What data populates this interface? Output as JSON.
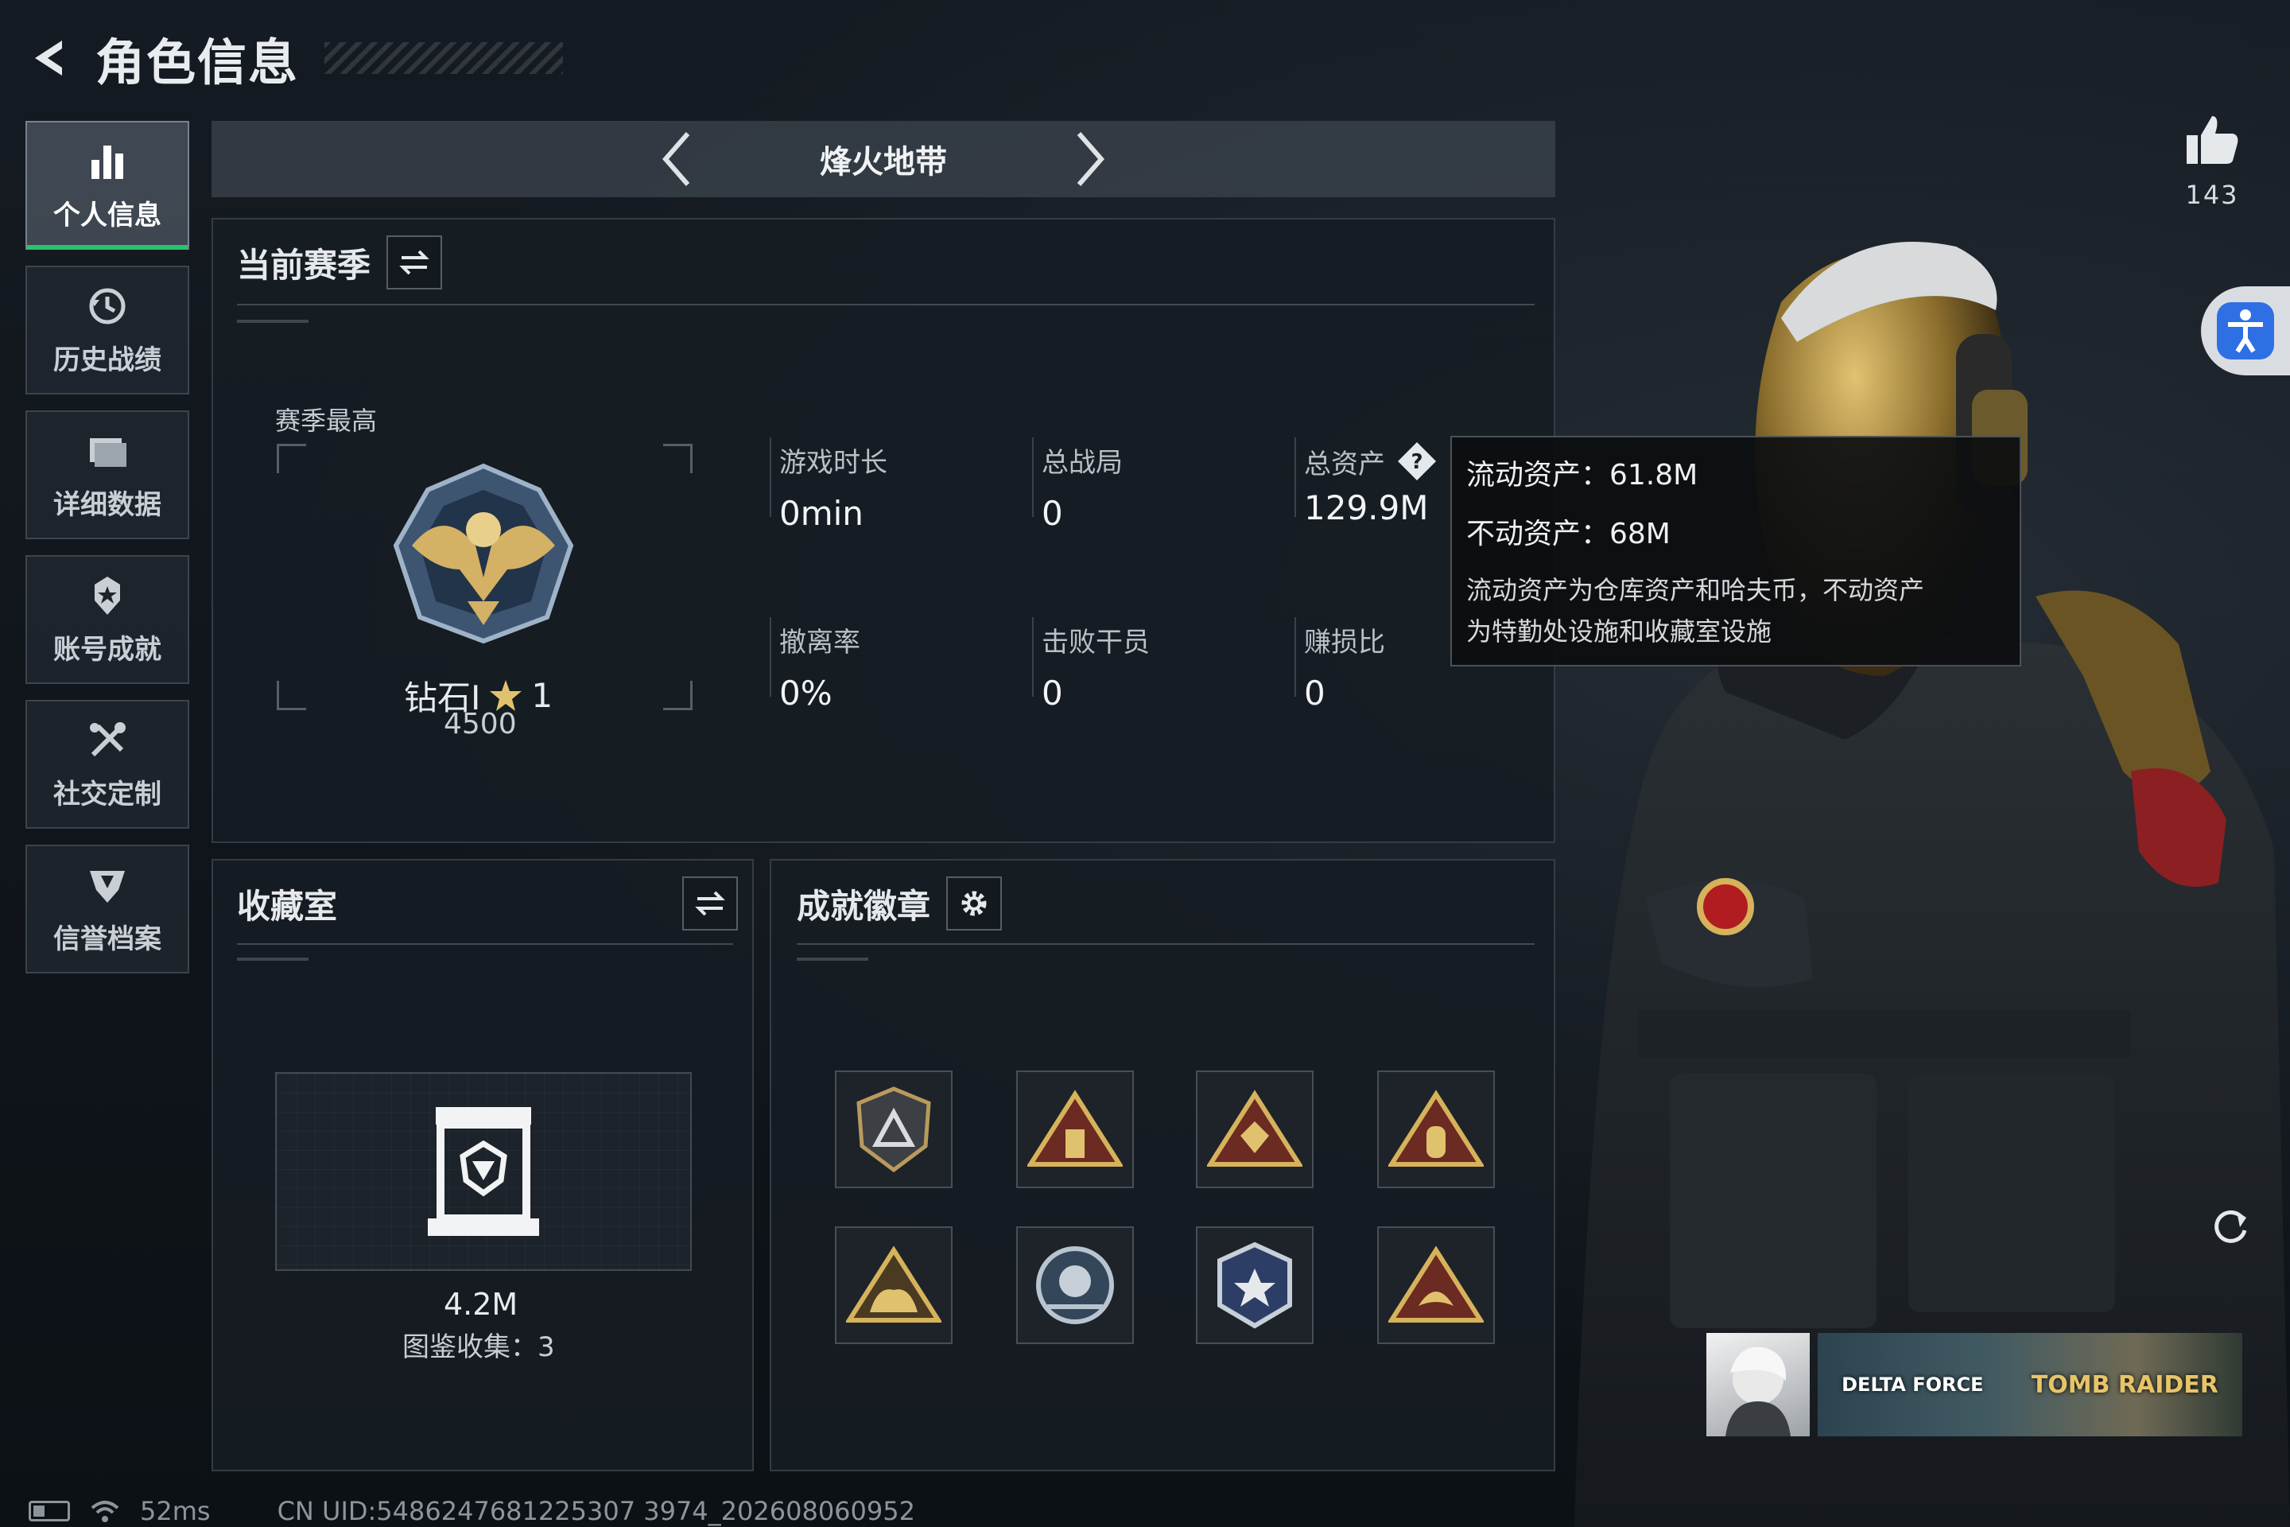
{
  "header": {
    "title": "角色信息"
  },
  "sidebar": {
    "items": [
      {
        "label": "个人信息",
        "icon": "bar-chart-icon",
        "active": true
      },
      {
        "label": "历史战绩",
        "icon": "history-clock-icon"
      },
      {
        "label": "详细数据",
        "icon": "folder-data-icon"
      },
      {
        "label": "账号成就",
        "icon": "achievement-star-icon"
      },
      {
        "label": "社交定制",
        "icon": "tools-icon"
      },
      {
        "label": "信誉档案",
        "icon": "shield-heart-icon"
      }
    ]
  },
  "mode": {
    "title": "烽火地带"
  },
  "season": {
    "title": "当前赛季",
    "best_label": "赛季最高",
    "rank_name": "钻石I",
    "rank_stars": "1",
    "rank_score": "4500",
    "stats": [
      {
        "label": "游戏时长",
        "value": "0min"
      },
      {
        "label": "总战局",
        "value": "0"
      },
      {
        "label": "总资产",
        "value": "129.9M"
      },
      {
        "label": "撤离率",
        "value": "0%"
      },
      {
        "label": "击败干员",
        "value": "0"
      },
      {
        "label": "赚损比",
        "value": "0"
      }
    ]
  },
  "tooltip": {
    "liquid": "流动资产：61.8M",
    "fixed": "不动资产：68M",
    "desc_line1": "流动资产为仓库资产和哈夫币，不动资产",
    "desc_line2": "为特勤处设施和收藏室设施"
  },
  "vault": {
    "title": "收藏室",
    "value": "4.2M",
    "collection": "图鉴收集：3"
  },
  "badges": {
    "title": "成就徽章",
    "items": [
      "shield-triangle-badge",
      "tower-triangle-badge",
      "diamond-triangle-badge",
      "capsule-triangle-badge",
      "beast-triangle-badge",
      "planet-round-badge",
      "star-hex-badge",
      "fish-triangle-badge"
    ]
  },
  "likes": {
    "count": "143"
  },
  "banner": {
    "game_a": "DELTA FORCE",
    "game_b": "TOMB RAIDER"
  },
  "status": {
    "ping": "52ms",
    "uid": "CN UID:5486247681225307 3974_202608060952"
  },
  "colors": {
    "accent_green": "#27c46b",
    "accessibility_blue": "#2f6fe4"
  }
}
